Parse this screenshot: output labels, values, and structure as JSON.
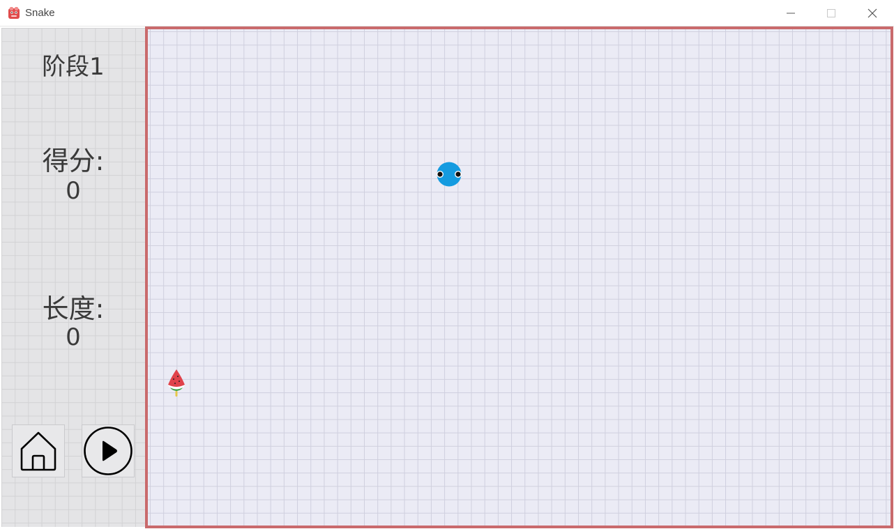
{
  "window": {
    "title": "Snake",
    "icon": "snake-app-icon",
    "controls": [
      "minimize-icon",
      "maximize-icon",
      "close-icon"
    ]
  },
  "sidebar": {
    "stage": "阶段1",
    "score_label": "得分:",
    "score_value": "0",
    "length_label": "长度:",
    "length_value": "0",
    "buttons": {
      "home": "home-icon",
      "play": "play-circle-icon"
    }
  },
  "board": {
    "border_color": "#c96a6c",
    "background_color": "#ebebf5",
    "snake": {
      "head_color": "#149be0",
      "eyes": "black"
    },
    "food": {
      "type": "watermelon-popsicle-icon"
    }
  }
}
